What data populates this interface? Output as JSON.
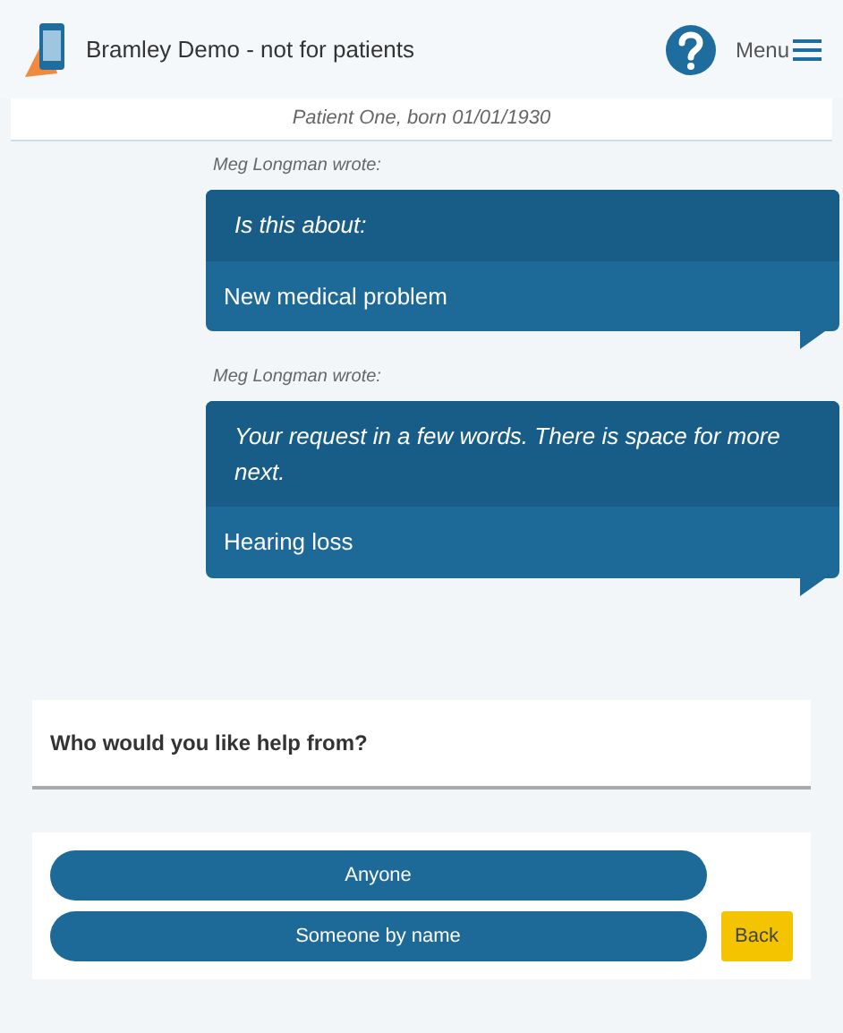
{
  "header": {
    "title": "Bramley Demo - not for patients",
    "menu": "Menu"
  },
  "patient_bar": "Patient One, born 01/01/1930",
  "messages": [
    {
      "author": "Meg Longman wrote:",
      "question": "Is this about:",
      "answer": "New medical problem"
    },
    {
      "author": "Meg Longman wrote:",
      "question": "Your request in a few words. There is space for more next.",
      "answer": "Hearing loss"
    }
  ],
  "prompt": "Who would you like help from?",
  "options": [
    "Anyone",
    "Someone by name"
  ],
  "back_button": "Back"
}
